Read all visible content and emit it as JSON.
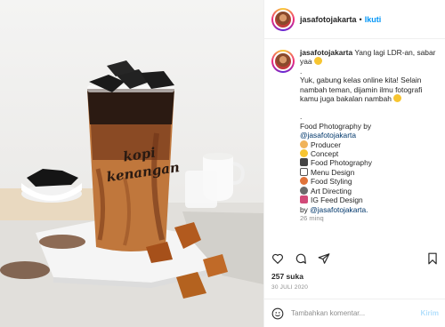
{
  "post": {
    "photo_text": [
      "kopi",
      "kenangan"
    ],
    "username": "jasafotojakarta",
    "follow_label": "Ikuti",
    "caption": {
      "username": "jasafotojakarta",
      "first_line": "Yang lagi LDR-an, sabar yaa",
      "p2": "Yuk, gabung kelas online kita! Selain nambah teman, dijamin ilmu fotografi kamu juga bakalan nambah",
      "credit_line": "Food Photography by",
      "credit_handle": "@jasafotojakarta",
      "roles": [
        "Producer",
        "Concept",
        "Food Photography",
        "Menu Design",
        "Food Styling",
        "Art Directing",
        "IG Feed Design"
      ],
      "by_prefix": "by",
      "by_handle": "@jasafotojakarta."
    },
    "time_ago": "26 minq",
    "likes": "257 suka",
    "date": "30 JULI 2020",
    "comment": {
      "placeholder": "Tambahkan komentar...",
      "post_label": "Kirim"
    },
    "icons": [
      "heart-icon",
      "comment-icon",
      "share-icon",
      "bookmark-icon",
      "emoji-icon"
    ]
  }
}
